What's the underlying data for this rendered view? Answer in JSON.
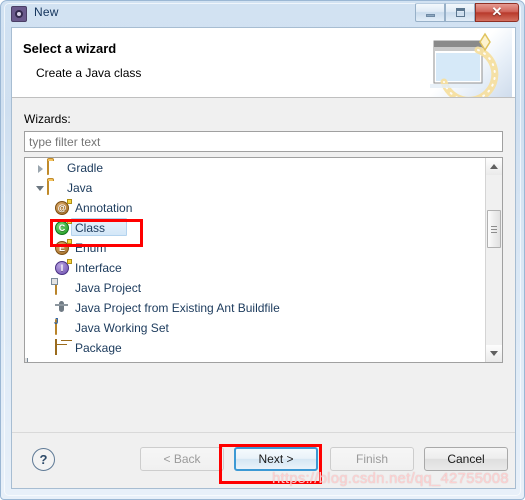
{
  "window": {
    "title": "New",
    "icon": "eclipse-new-icon",
    "controls": {
      "minimize": "–",
      "maximize": "□",
      "close": "✕"
    }
  },
  "banner": {
    "title": "Select a wizard",
    "subtitle": "Create a Java class",
    "graphic": "wizard-banner-graphic"
  },
  "wizards": {
    "label": "Wizards:",
    "filter": {
      "value": "",
      "placeholder": "type filter text"
    },
    "tree": [
      {
        "label": "Gradle",
        "level": 0,
        "twisty": "collapsed",
        "icon": "folder-icon",
        "selected": false
      },
      {
        "label": "Java",
        "level": 0,
        "twisty": "expanded",
        "icon": "folder-icon",
        "selected": false
      },
      {
        "label": "Annotation",
        "level": 1,
        "twisty": "none",
        "icon": "annotation-icon",
        "selected": false
      },
      {
        "label": "Class",
        "level": 1,
        "twisty": "none",
        "icon": "class-icon",
        "selected": true
      },
      {
        "label": "Enum",
        "level": 1,
        "twisty": "none",
        "icon": "enum-icon",
        "selected": false
      },
      {
        "label": "Interface",
        "level": 1,
        "twisty": "none",
        "icon": "interface-icon",
        "selected": false
      },
      {
        "label": "Java Project",
        "level": 1,
        "twisty": "none",
        "icon": "java-project-icon",
        "selected": false
      },
      {
        "label": "Java Project from Existing Ant Buildfile",
        "level": 1,
        "twisty": "none",
        "icon": "ant-icon",
        "selected": false
      },
      {
        "label": "Java Working Set",
        "level": 1,
        "twisty": "none",
        "icon": "working-set-icon",
        "selected": false
      },
      {
        "label": "Package",
        "level": 1,
        "twisty": "none",
        "icon": "package-icon",
        "selected": false
      }
    ],
    "scrollbar": {
      "up_arrow": "▲",
      "down_arrow": "▼"
    }
  },
  "buttons": {
    "help": "?",
    "back": "< Back",
    "next": "Next >",
    "finish": "Finish",
    "cancel": "Cancel"
  },
  "watermark": "https://blog.csdn.net/qq_42755008",
  "colors": {
    "annotation_red": "#ff0000",
    "focus_blue": "#3c99d4",
    "selection_blue": "#d3e7f8",
    "title_text": "#14345c",
    "close_red": "#b83a2c"
  }
}
